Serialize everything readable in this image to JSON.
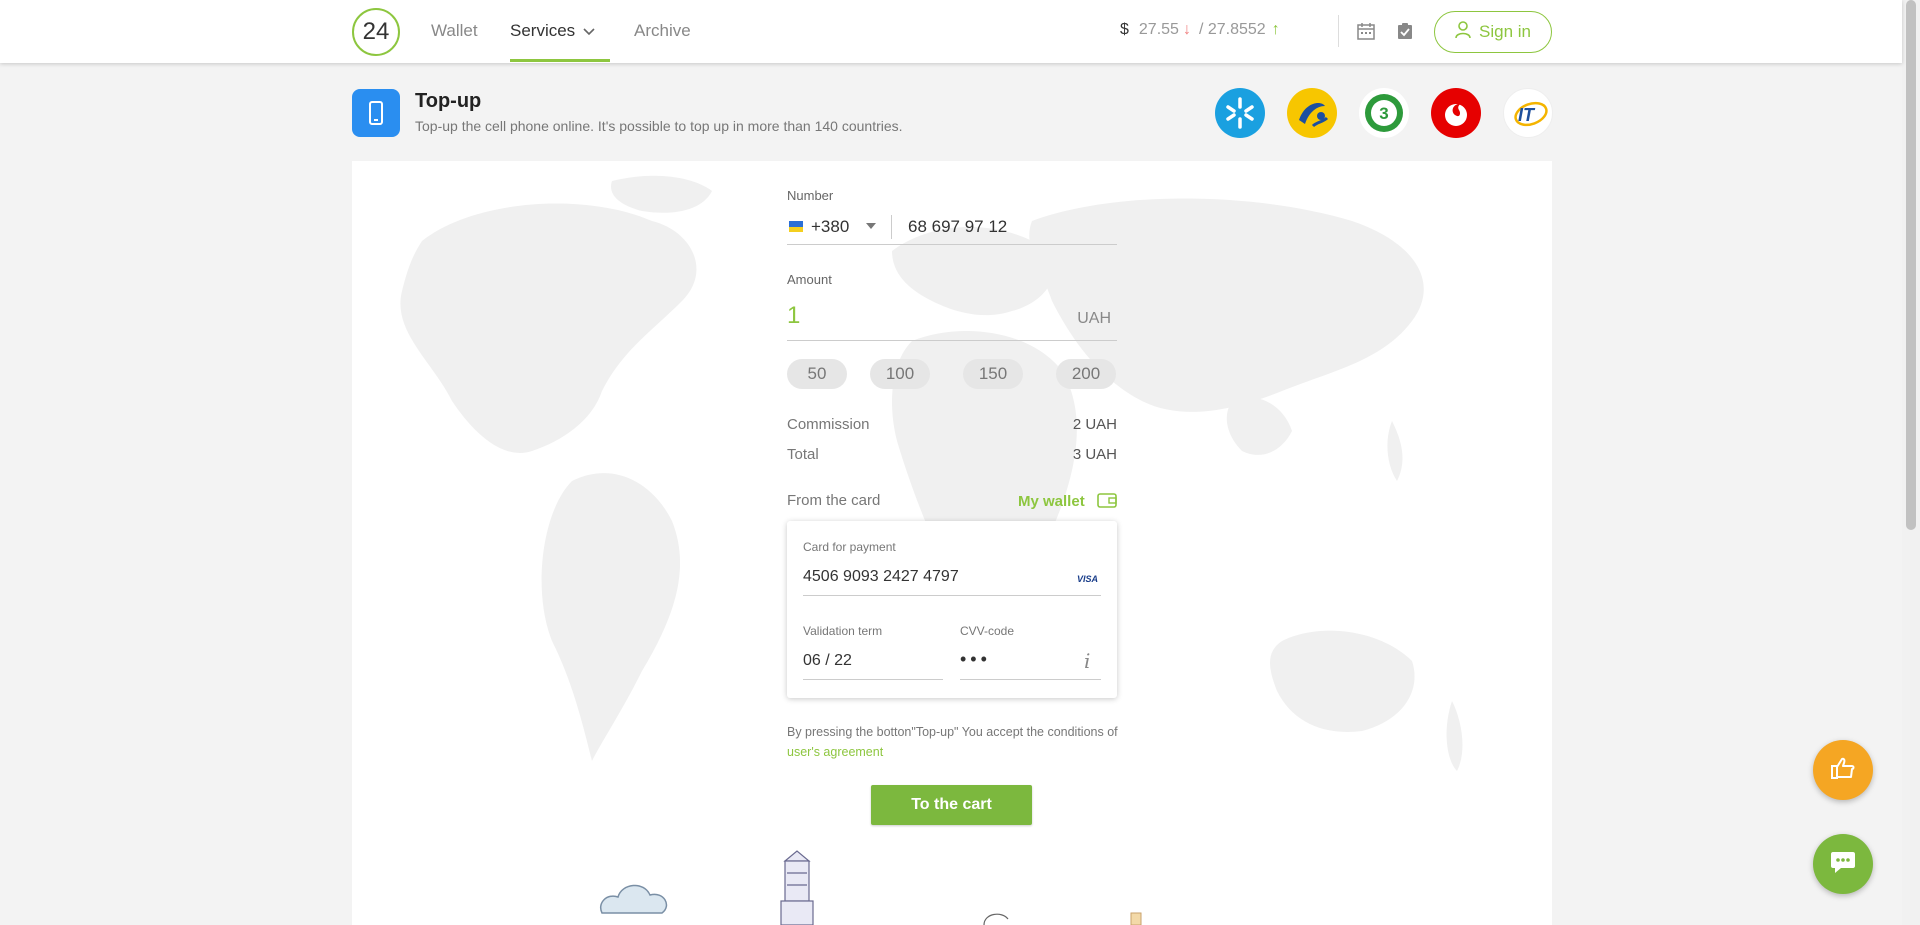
{
  "header": {
    "logo": "24",
    "nav": {
      "wallet": "Wallet",
      "services": "Services",
      "archive": "Archive"
    },
    "rates": {
      "currency": "$",
      "buy": "27.55",
      "sell": "/ 27.8552",
      "down_arrow": "↓",
      "up_arrow": "↑"
    },
    "sign_in": "Sign in"
  },
  "page": {
    "title": "Top-up",
    "subtitle": "Top-up the cell phone online. It's possible to top up in more than 140 countries."
  },
  "operators": [
    "kyivstar-logo",
    "lifecell-logo",
    "3mob-logo",
    "vodafone-logo",
    "intertelecom-logo"
  ],
  "form": {
    "number_label": "Number",
    "country_code": "+380",
    "phone": "68 697 97 12",
    "amount_label": "Amount",
    "amount": "1",
    "amount_currency": "UAH",
    "quick_amounts": [
      "50",
      "100",
      "150",
      "200"
    ],
    "commission_label": "Commission",
    "commission_value": "2 UAH",
    "total_label": "Total",
    "total_value": "3 UAH",
    "from_card_label": "From the card",
    "my_wallet": "My wallet",
    "card": {
      "card_label": "Card for payment",
      "card_number": "4506 9093 2427 4797",
      "brand": "VISA",
      "term_label": "Validation term",
      "term_value": "06 / 22",
      "cvv_label": "CVV-code",
      "cvv_value": "•••",
      "info": "i"
    },
    "agreement_prefix": "By pressing the botton\"Top-up\" You accept the conditions of",
    "agreement_link": "user's agreement",
    "submit": "To the cart"
  },
  "colors": {
    "accent": "#8dc63f",
    "button": "#7cb83e",
    "like": "#f5a623",
    "title_icon": "#2a8ef0"
  }
}
